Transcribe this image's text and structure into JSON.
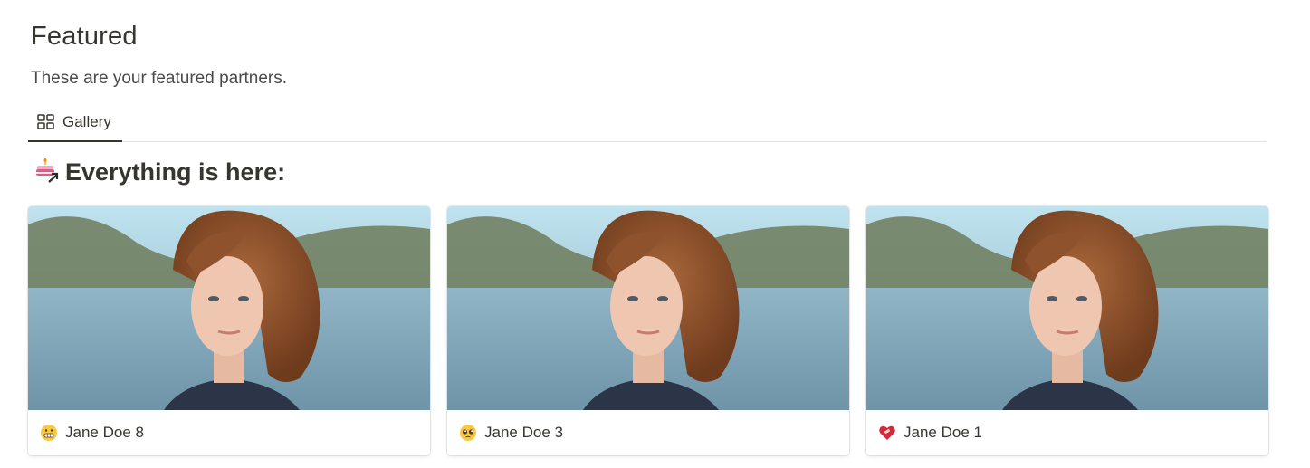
{
  "page": {
    "title": "Featured",
    "description": "These are your featured partners."
  },
  "views": {
    "tabs": [
      {
        "label": "Gallery",
        "icon": "gallery-grid-icon",
        "active": true
      }
    ]
  },
  "section": {
    "title": "Everything is here:",
    "icon": "cake-arrow-icon"
  },
  "gallery": {
    "cards": [
      {
        "name": "Jane Doe 8",
        "icon": "grimacing-face-icon",
        "cover": "portrait-photo"
      },
      {
        "name": "Jane Doe 3",
        "icon": "pleading-face-icon",
        "cover": "portrait-photo"
      },
      {
        "name": "Jane Doe 1",
        "icon": "mending-heart-icon",
        "cover": "portrait-photo"
      }
    ]
  },
  "colors": {
    "text": "#37352f",
    "divider": "#e3e2e0",
    "sky": "#b9dbe8",
    "water": "#7aa0b3",
    "hair": "#8a4e27"
  }
}
